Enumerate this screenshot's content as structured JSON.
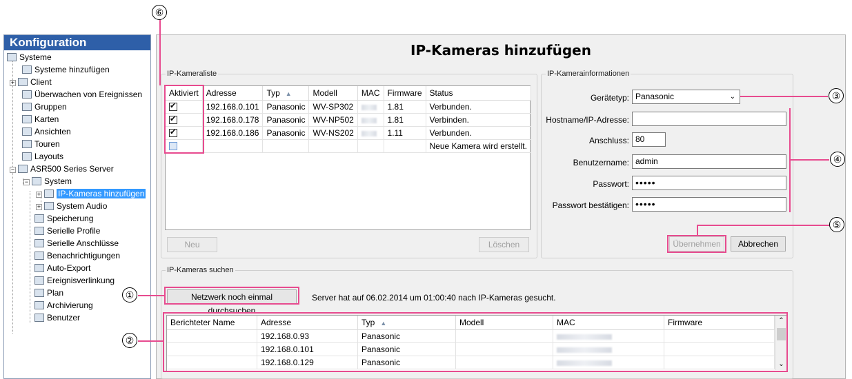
{
  "sidebar": {
    "title": "Konfiguration",
    "items": [
      {
        "label": "Systeme",
        "icon": "systems-icon"
      },
      {
        "label": "Systeme hinzufügen",
        "icon": "add-system-icon"
      },
      {
        "label": "Client",
        "icon": "client-icon"
      },
      {
        "label": "Überwachen von Ereignissen",
        "icon": "monitor-events-icon"
      },
      {
        "label": "Gruppen",
        "icon": "groups-icon"
      },
      {
        "label": "Karten",
        "icon": "maps-icon"
      },
      {
        "label": "Ansichten",
        "icon": "views-icon"
      },
      {
        "label": "Touren",
        "icon": "tours-icon"
      },
      {
        "label": "Layouts",
        "icon": "layouts-icon"
      },
      {
        "label": "ASR500 Series Server",
        "icon": "server-icon"
      },
      {
        "label": "System",
        "icon": "system-icon"
      },
      {
        "label": "IP-Kameras hinzufügen",
        "icon": "ip-camera-icon"
      },
      {
        "label": "System Audio",
        "icon": "audio-icon"
      },
      {
        "label": "Speicherung",
        "icon": "storage-icon"
      },
      {
        "label": "Serielle Profile",
        "icon": "serial-profile-icon"
      },
      {
        "label": "Serielle Anschlüsse",
        "icon": "serial-port-icon"
      },
      {
        "label": "Benachrichtigungen",
        "icon": "notification-icon"
      },
      {
        "label": "Auto-Export",
        "icon": "auto-export-icon"
      },
      {
        "label": "Ereignisverlinkung",
        "icon": "event-link-icon"
      },
      {
        "label": "Plan",
        "icon": "plan-icon"
      },
      {
        "label": "Archivierung",
        "icon": "archive-icon"
      },
      {
        "label": "Benutzer",
        "icon": "user-icon"
      }
    ]
  },
  "main": {
    "title": "IP-Kameras hinzufügen",
    "camera_list": {
      "legend": "IP-Kameraliste",
      "columns": [
        "Aktiviert",
        "Adresse",
        "Typ",
        "Modell",
        "MAC",
        "Firmware",
        "Status"
      ],
      "rows": [
        {
          "active": true,
          "address": "192.168.0.101",
          "type": "Panasonic",
          "model": "WV-SP302",
          "firmware": "1.81",
          "status": "Verbunden."
        },
        {
          "active": true,
          "address": "192.168.0.178",
          "type": "Panasonic",
          "model": "WV-NP502",
          "firmware": "1.81",
          "status": "Verbinden."
        },
        {
          "active": true,
          "address": "192.168.0.186",
          "type": "Panasonic",
          "model": "WV-NS202",
          "firmware": "1.11",
          "status": "Verbunden."
        },
        {
          "active": false,
          "address": "",
          "type": "",
          "model": "",
          "firmware": "",
          "status": "Neue Kamera wird erstellt."
        }
      ],
      "new_label": "Neu",
      "delete_label": "Löschen"
    },
    "camera_info": {
      "legend": "IP-Kamerainformationen",
      "device_type_label": "Gerätetyp:",
      "device_type_value": "Panasonic",
      "hostname_label": "Hostname/IP-Adresse:",
      "hostname_value": "",
      "port_label": "Anschluss:",
      "port_value": "80",
      "username_label": "Benutzername:",
      "username_value": "admin",
      "password_label": "Passwort:",
      "password_value": "•••••",
      "confirm_label": "Passwort bestätigen:",
      "confirm_value": "•••••",
      "apply_label": "Übernehmen",
      "cancel_label": "Abbrechen"
    },
    "search": {
      "legend": "IP-Kameras suchen",
      "rescan_label": "Netzwerk noch einmal durchsuchen",
      "status_text": "Server hat auf 06.02.2014 um 01:00:40 nach IP-Kameras gesucht.",
      "columns": [
        "Berichteter Name",
        "Adresse",
        "Typ",
        "Modell",
        "MAC",
        "Firmware"
      ],
      "rows": [
        {
          "name": "",
          "address": "192.168.0.93",
          "type": "Panasonic",
          "model": "",
          "firmware": ""
        },
        {
          "name": "",
          "address": "192.168.0.101",
          "type": "Panasonic",
          "model": "",
          "firmware": ""
        },
        {
          "name": "",
          "address": "192.168.0.129",
          "type": "Panasonic",
          "model": "",
          "firmware": ""
        }
      ]
    }
  },
  "callouts": [
    "①",
    "②",
    "③",
    "④",
    "⑤",
    "⑥"
  ],
  "colors": {
    "accent": "#2e5fa8",
    "highlight": "#e74b8f",
    "selection": "#3399ff"
  }
}
